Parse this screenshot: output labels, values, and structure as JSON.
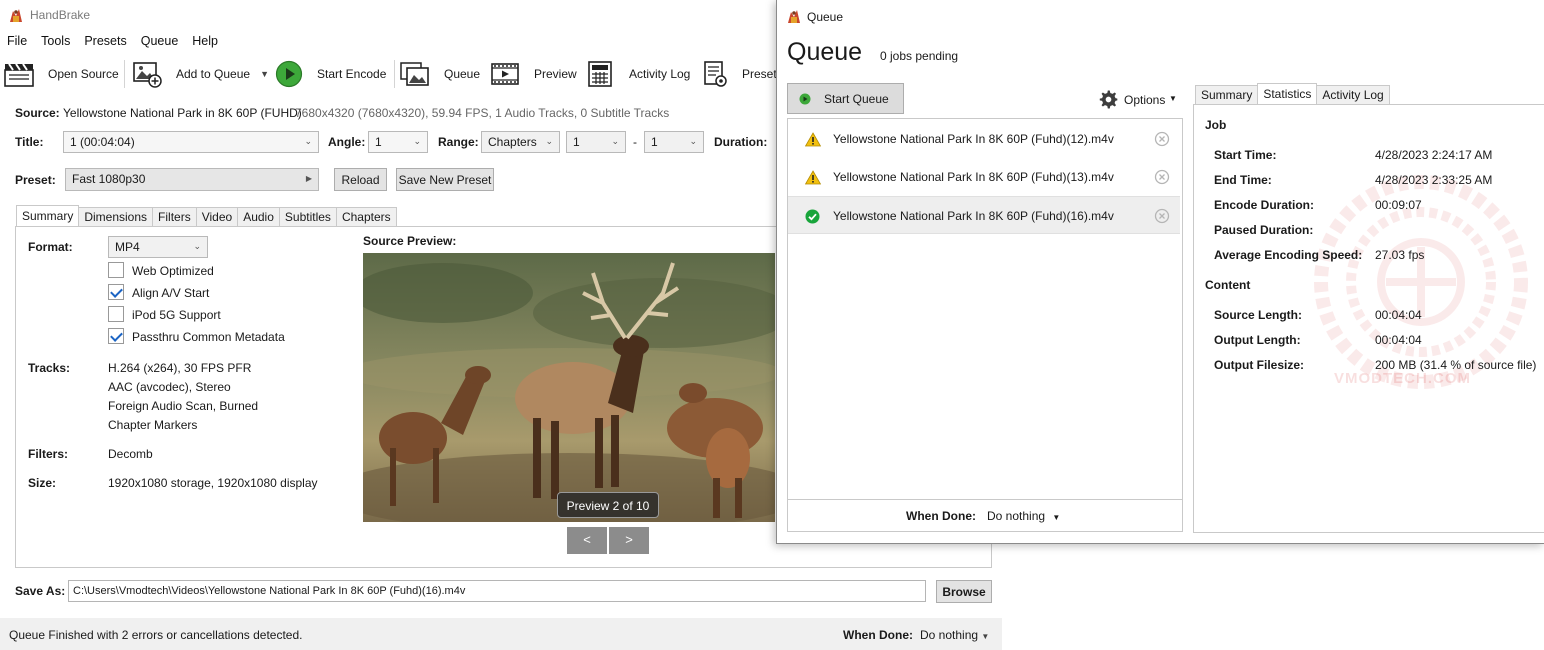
{
  "main": {
    "title": "HandBrake",
    "menu": [
      "File",
      "Tools",
      "Presets",
      "Queue",
      "Help"
    ],
    "toolbar": {
      "open_source": "Open Source",
      "add_to_queue": "Add to Queue",
      "start_encode": "Start Encode",
      "queue": "Queue",
      "preview": "Preview",
      "activity_log": "Activity Log",
      "presets": "Presets"
    },
    "source": {
      "label": "Source:",
      "name": "Yellowstone National Park in 8K 60P (FUHD)",
      "info": "7680x4320 (7680x4320), 59.94 FPS, 1 Audio Tracks, 0 Subtitle Tracks"
    },
    "title_row": {
      "title_label": "Title:",
      "title_value": "1  (00:04:04)",
      "angle_label": "Angle:",
      "angle_value": "1",
      "range_label": "Range:",
      "range_value": "Chapters",
      "range_from": "1",
      "range_dash": "-",
      "range_to": "1",
      "duration_label": "Duration:"
    },
    "preset": {
      "label": "Preset:",
      "value": "Fast 1080p30",
      "reload": "Reload",
      "save_new": "Save New Preset"
    },
    "tabs": [
      "Summary",
      "Dimensions",
      "Filters",
      "Video",
      "Audio",
      "Subtitles",
      "Chapters"
    ],
    "summary": {
      "format_label": "Format:",
      "format_value": "MP4",
      "checks": [
        {
          "label": "Web Optimized",
          "checked": false
        },
        {
          "label": "Align A/V Start",
          "checked": true
        },
        {
          "label": "iPod 5G Support",
          "checked": false
        },
        {
          "label": "Passthru Common Metadata",
          "checked": true
        }
      ],
      "tracks_label": "Tracks:",
      "tracks": [
        "H.264 (x264), 30 FPS PFR",
        "AAC (avcodec), Stereo",
        "Foreign Audio Scan, Burned",
        "Chapter Markers"
      ],
      "filters_label": "Filters:",
      "filters_value": "Decomb",
      "size_label": "Size:",
      "size_value": "1920x1080 storage, 1920x1080 display",
      "preview_label": "Source Preview:",
      "preview_badge": "Preview 2 of 10",
      "prev_btn": "<",
      "next_btn": ">"
    },
    "save_as": {
      "label": "Save As:",
      "path": "C:\\Users\\Vmodtech\\Videos\\Yellowstone National Park In 8K 60P (Fuhd)(16).m4v",
      "browse": "Browse"
    },
    "status": {
      "message": "Queue Finished with 2 errors or cancellations detected.",
      "when_done_label": "When Done:",
      "when_done_value": "Do nothing"
    }
  },
  "queue": {
    "window_title": "Queue",
    "heading": "Queue",
    "pending": "0 jobs pending",
    "start_queue": "Start Queue",
    "options": "Options",
    "jobs": [
      {
        "name": "Yellowstone National Park In 8K 60P (Fuhd)(12).m4v",
        "status": "warning-icon"
      },
      {
        "name": "Yellowstone National Park In 8K 60P (Fuhd)(13).m4v",
        "status": "warning-icon"
      },
      {
        "name": "Yellowstone National Park In 8K 60P (Fuhd)(16).m4v",
        "status": "success-icon"
      }
    ],
    "when_done_label": "When Done:",
    "when_done_value": "Do nothing",
    "tabs": [
      "Summary",
      "Statistics",
      "Activity Log"
    ],
    "job_heading": "Job",
    "content_heading": "Content",
    "stats": {
      "start_time": {
        "label": "Start Time:",
        "value": "4/28/2023 2:24:17 AM"
      },
      "end_time": {
        "label": "End Time:",
        "value": "4/28/2023 2:33:25 AM"
      },
      "encode_duration": {
        "label": "Encode Duration:",
        "value": "00:09:07"
      },
      "paused_duration": {
        "label": "Paused Duration:",
        "value": ""
      },
      "avg_speed": {
        "label": "Average Encoding Speed:",
        "value": "27.03 fps"
      },
      "source_length": {
        "label": "Source Length:",
        "value": "00:04:04"
      },
      "output_length": {
        "label": "Output Length:",
        "value": "00:04:04"
      },
      "output_filesize": {
        "label": "Output Filesize:",
        "value": "200 MB (31.4 % of source file)"
      }
    },
    "watermark": "VMODTECH.COM"
  },
  "colors": {
    "accent": "#1b64c4",
    "warning": "#f2c00f",
    "success": "#19a53b",
    "toolbar_bg": "#ffffff",
    "status_bg": "#f0f0f0"
  }
}
